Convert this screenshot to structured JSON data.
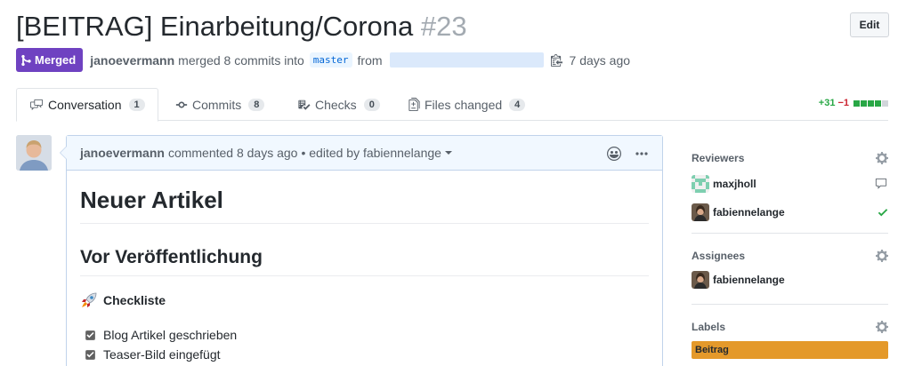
{
  "pr": {
    "title": "[BEITRAG] Einarbeitung/Corona",
    "number": "#23",
    "edit_label": "Edit",
    "state_label": "Merged",
    "author": "janoevermann",
    "merged_text": "merged 8 commits into",
    "base_branch": "master",
    "from_text": "from",
    "time": "7 days ago"
  },
  "tabs": [
    {
      "label": "Conversation",
      "count": "1"
    },
    {
      "label": "Commits",
      "count": "8"
    },
    {
      "label": "Checks",
      "count": "0"
    },
    {
      "label": "Files changed",
      "count": "4"
    }
  ],
  "diffstat": {
    "additions": "+31",
    "deletions": "−1"
  },
  "comment": {
    "author": "janoevermann",
    "action": "commented 8 days ago",
    "edited": "• edited by fabiennelange",
    "h1": "Neuer Artikel",
    "h2": "Vor Veröffentlichung",
    "h3": "Checkliste",
    "tasks": [
      "Blog Artikel geschrieben",
      "Teaser-Bild eingefügt"
    ]
  },
  "sidebar": {
    "reviewers_title": "Reviewers",
    "reviewers": [
      {
        "name": "maxjholl",
        "status": "comment-icon"
      },
      {
        "name": "fabiennelange",
        "status": "check-icon"
      }
    ],
    "assignees_title": "Assignees",
    "assignees": [
      {
        "name": "fabiennelange"
      }
    ],
    "labels_title": "Labels",
    "labels": [
      {
        "name": "Beitrag",
        "color": "#e4992a"
      }
    ]
  },
  "colors": {
    "merged": "#6f42c1",
    "link": "#0366d6",
    "add": "#28a745",
    "del": "#cb2431",
    "label_beitrag": "#e4992a"
  }
}
